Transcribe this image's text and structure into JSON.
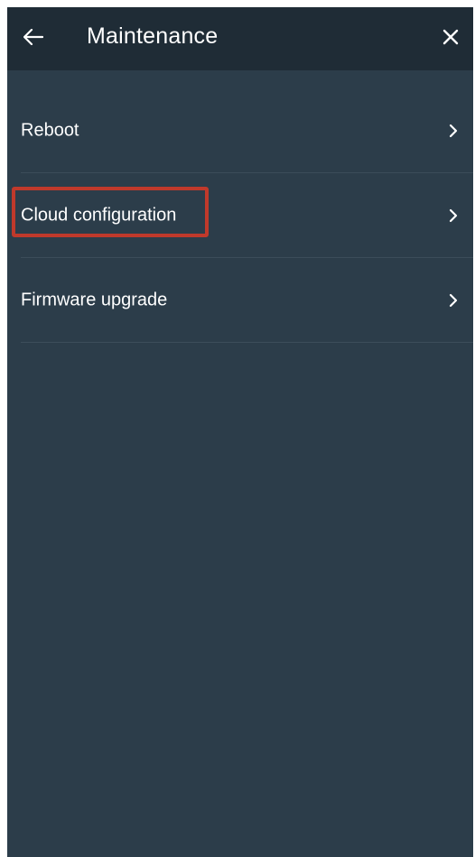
{
  "header": {
    "title": "Maintenance",
    "back_icon": "arrow-left-icon",
    "close_icon": "close-icon",
    "background": "#1f2c36"
  },
  "menu": {
    "items": [
      {
        "label": "Reboot",
        "icon": "chevron-right-icon"
      },
      {
        "label": "Cloud configuration",
        "icon": "chevron-right-icon",
        "highlighted": true
      },
      {
        "label": "Firmware upgrade",
        "icon": "chevron-right-icon"
      }
    ]
  },
  "colors": {
    "background": "#2c3d4a",
    "text": "#ffffff",
    "highlight": "#c0392b"
  }
}
